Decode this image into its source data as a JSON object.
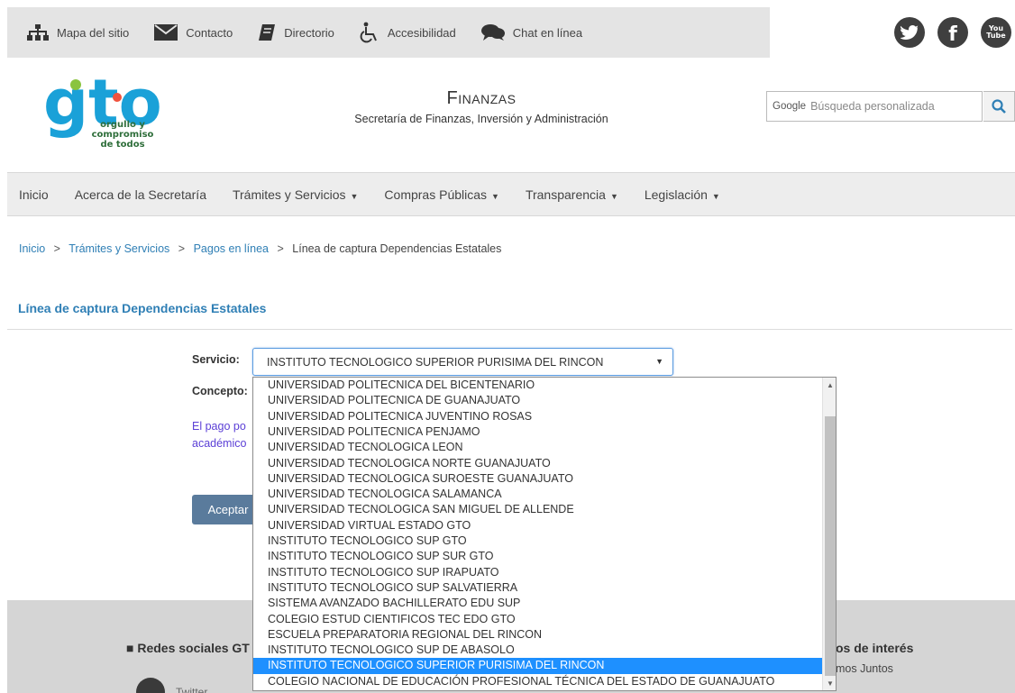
{
  "topbar": {
    "links": [
      {
        "label": "Mapa del sitio",
        "icon": "sitemap-icon"
      },
      {
        "label": "Contacto",
        "icon": "envelope-icon"
      },
      {
        "label": "Directorio",
        "icon": "book-icon"
      },
      {
        "label": "Accesibilidad",
        "icon": "wheelchair-icon"
      },
      {
        "label": "Chat en línea",
        "icon": "chat-icon"
      }
    ],
    "social": [
      {
        "name": "twitter",
        "icon": "twitter-icon"
      },
      {
        "name": "facebook",
        "icon": "facebook-icon",
        "glyph": "f"
      },
      {
        "name": "youtube",
        "icon": "youtube-icon",
        "glyph": "You\nTube"
      }
    ]
  },
  "header": {
    "logo_text": "gto",
    "logo_tagline": "orgullo y compromiso de todos",
    "title": "Finanzas",
    "subtitle": "Secretaría de Finanzas, Inversión y Administración",
    "search_brand": "Google",
    "search_placeholder": "Búsqueda personalizada"
  },
  "nav": {
    "items": [
      {
        "label": "Inicio",
        "caret": false
      },
      {
        "label": "Acerca de la Secretaría",
        "caret": false
      },
      {
        "label": "Trámites y Servicios",
        "caret": true
      },
      {
        "label": "Compras Públicas",
        "caret": true
      },
      {
        "label": "Transparencia",
        "caret": true
      },
      {
        "label": "Legislación",
        "caret": true
      }
    ]
  },
  "breadcrumb": {
    "items": [
      "Inicio",
      "Trámites y Servicios",
      "Pagos en línea"
    ],
    "current": "Línea de captura Dependencias Estatales",
    "separator": ">"
  },
  "page": {
    "title": "Línea de captura Dependencias Estatales"
  },
  "form": {
    "servicio_label": "Servicio:",
    "concepto_label": "Concepto:",
    "selected_value": "INSTITUTO TECNOLOGICO SUPERIOR PURISIMA DEL RINCON",
    "note_line1": "El pago po",
    "note_line2": "académico",
    "accept_label": "Aceptar"
  },
  "dropdown": {
    "options": [
      "UNIVERSIDAD POLITECNICA DEL BICENTENARIO",
      "UNIVERSIDAD POLITECNICA DE GUANAJUATO",
      "UNIVERSIDAD POLITECNICA JUVENTINO ROSAS",
      "UNIVERSIDAD POLITECNICA PENJAMO",
      "UNIVERSIDAD TECNOLOGICA LEON",
      "UNIVERSIDAD TECNOLOGICA NORTE GUANAJUATO",
      "UNIVERSIDAD TECNOLOGICA SUROESTE GUANAJUATO",
      "UNIVERSIDAD TECNOLOGICA SALAMANCA",
      "UNIVERSIDAD TECNOLOGICA SAN MIGUEL DE ALLENDE",
      "UNIVERSIDAD VIRTUAL ESTADO GTO",
      "INSTITUTO TECNOLOGICO SUP GTO",
      "INSTITUTO TECNOLOGICO SUP SUR GTO",
      "INSTITUTO TECNOLOGICO SUP IRAPUATO",
      "INSTITUTO TECNOLOGICO SUP SALVATIERRA",
      "SISTEMA AVANZADO BACHILLERATO EDU SUP",
      "COLEGIO ESTUD CIENTIFICOS TEC EDO GTO",
      "ESCUELA PREPARATORIA REGIONAL DEL RINCON",
      "INSTITUTO TECNOLOGICO SUP DE ABASOLO",
      "INSTITUTO TECNOLOGICO SUPERIOR PURISIMA DEL RINCON",
      "COLEGIO NACIONAL DE EDUCACIÓN PROFESIONAL TÉCNICA DEL ESTADO DE GUANAJUATO"
    ],
    "selected_index": 18
  },
  "footer": {
    "social_heading": "Redes sociales GT",
    "links_heading": "os de interés",
    "links_sub": "mos Juntos",
    "twitter_label": "Twitter"
  },
  "colors": {
    "accent": "#2f7fb5",
    "selected": "#1e90ff",
    "button": "#5a7b9c",
    "note": "#5b3fd6"
  }
}
